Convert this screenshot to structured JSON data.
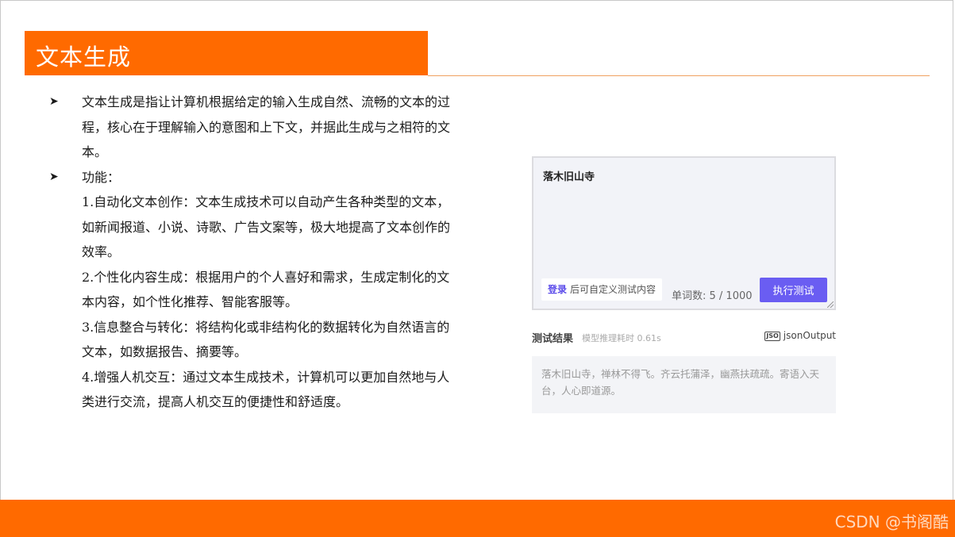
{
  "slide": {
    "title": "文本生成",
    "intro_bullet": "文本生成是指让计算机根据给定的输入生成自然、流畅的文本的过程，核心在于理解输入的意图和上下文，并据此生成与之相符的文本。",
    "features_label": "功能：",
    "features": [
      "1.自动化文本创作：文本生成技术可以自动产生各种类型的文本，如新闻报道、小说、诗歌、广告文案等，极大地提高了文本创作的效率。",
      "2.个性化内容生成：根据用户的个人喜好和需求，生成定制化的文本内容，如个性化推荐、智能客服等。",
      "3.信息整合与转化：将结构化或非结构化的数据转化为自然语言的文本，如数据报告、摘要等。",
      "4.增强人机交互：通过文本生成技术，计算机可以更加自然地与人类进行交流，提高人机交互的便捷性和舒适度。"
    ],
    "bullet_glyph": "➤"
  },
  "demo": {
    "input_text": "落木旧山寺",
    "login_link": "登录",
    "login_hint": "后可自定义测试内容",
    "word_count": "单词数: 5 / 1000",
    "run_button": "执行测试",
    "result_title": "测试结果",
    "latency": "模型推理耗时 0.61s",
    "json_icon": "JSO",
    "json_label": "jsonOutput",
    "result_text": "落木旧山寺，禅林不得飞。齐云托蒲泽，幽燕扶疏疏。寄语入天台，人心即道源。"
  },
  "footer": {
    "watermark": "CSDN @书阁酷"
  },
  "colors": {
    "accent": "#ff6a00",
    "button": "#6a5df2"
  }
}
